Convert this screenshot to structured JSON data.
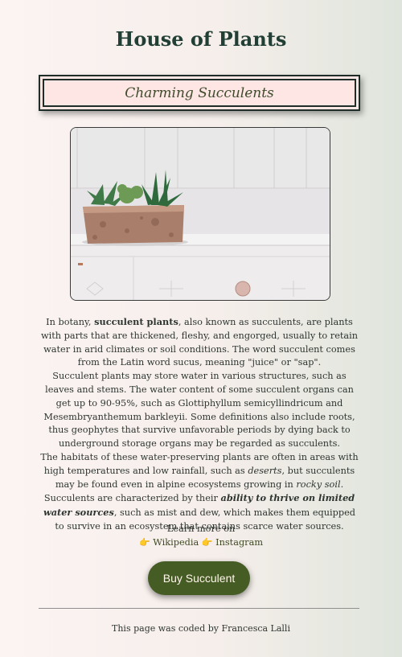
{
  "page": {
    "title": "House of Plants",
    "subtitle": "Charming Succulents"
  },
  "image": {
    "description_icon": "succulent-pot-photo"
  },
  "article": {
    "p1_a": "In botany, ",
    "p1_b": "succulent plants",
    "p1_c": ", also known as succulents, are plants with parts that are thickened, fleshy, and engorged, usually to retain water in arid climates or soil conditions. The word succulent comes from the Latin word sucus, meaning \"juice\" or \"sap\".",
    "p2": "Succulent plants may store water in various structures, such as leaves and stems. The water content of some succulent organs can get up to 90-95%, such as Glottiphyllum semicyllindricum and Mesembryanthemum barkleyii. Some definitions also include roots, thus geophytes that survive unfavorable periods by dying back to underground storage organs may be regarded as succulents.",
    "p3_a": "The habitats of these water-preserving plants are often in areas with high temperatures and low rainfall, such as ",
    "p3_b": "deserts",
    "p3_c": ", but succulents may be found even in alpine ecosystems growing in ",
    "p3_d": "rocky soil",
    "p3_e": ". Succulents are characterized by their ",
    "p3_f": "ability to thrive on limited water sources",
    "p3_g": ", such as mist and dew, which makes them equipped to survive in an ecosystem that contains scarce water sources."
  },
  "learn_more": {
    "label": "Learn more on",
    "hand": "👉",
    "wikipedia": "Wikipedia",
    "instagram": "Instagram"
  },
  "buy_button": "Buy Succulent",
  "footer": "This page was coded by Francesca Lalli",
  "colors": {
    "title": "#223f35",
    "button": "#465c25",
    "subtitle_bg": "#fde6e4"
  }
}
